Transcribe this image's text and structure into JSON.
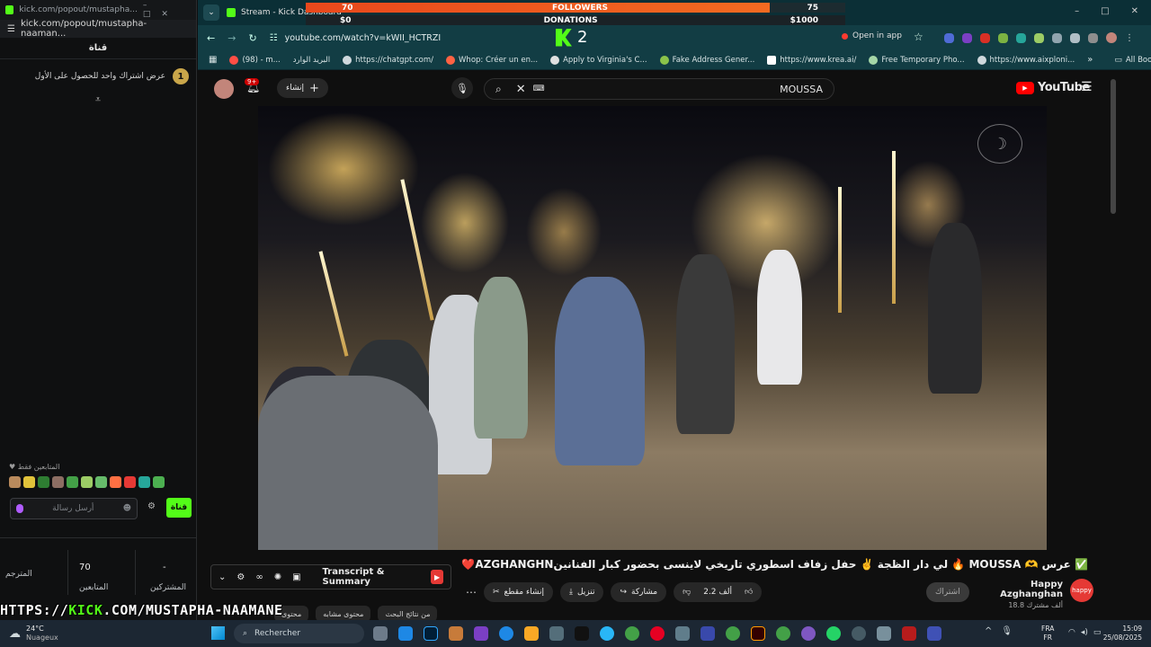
{
  "left_window": {
    "url_title": "kick.com/popout/mustapha...",
    "url": "kick.com/popout/mustapha-naaman...",
    "chat_header": "قناة",
    "pinned_text": "عرض اشتراك واحد للحصول على الأول",
    "pinned_badge": "1",
    "supporters_label": "المتابعين فقط",
    "input_placeholder": "أرسل رسالة",
    "send_label": "قناة",
    "stats": [
      {
        "value": "",
        "label": "المترجم"
      },
      {
        "value": "70",
        "label": "المتابعين"
      },
      {
        "value": "-",
        "label": "المشتركين"
      }
    ]
  },
  "browser": {
    "tab_title": "Stream - Kick Dashboard",
    "url": "youtube.com/watch?v=kWII_HCTRZI",
    "open_in_app": "Open in app",
    "kick_count": "2",
    "bookmarks": [
      {
        "label": "(98) - m...",
        "color": "#ff4e45"
      },
      {
        "label": "البريد الوارد",
        "color": "#ea4335"
      },
      {
        "label": "https://chatgpt.com/",
        "color": "#cfd8dc"
      },
      {
        "label": "Whop: Créer un en...",
        "color": "#ff6243"
      },
      {
        "label": "Apply to Virginia's C...",
        "color": "#e0e0e0"
      },
      {
        "label": "Fake Address Gener...",
        "color": "#8bc34a"
      },
      {
        "label": "https://www.krea.ai/",
        "color": "#ffffff"
      },
      {
        "label": "Free Temporary Pho...",
        "color": "#a5d6a7"
      },
      {
        "label": "https://www.aixploni...",
        "color": "#cfd8dc"
      }
    ],
    "all_bookmarks": "All Bookmarks"
  },
  "overlay": {
    "followers_left": "70",
    "followers_label": "FOLLOWERS",
    "followers_right": "75",
    "donations_left": "$0",
    "donations_label": "DONATIONS",
    "donations_right": "$1000"
  },
  "youtube": {
    "notif_count": "9+",
    "create_label": "إنشاء",
    "search_value": "MOUSSA",
    "logo": "YouTube",
    "video_title": "✅ عرس 🫶 MOUSSA 🔥 لي دار الظجة ✌️ حفل زفاف اسطوري تاريخي لاينسى بحضور كبار الفنانينAZGHANGHN❤️",
    "channel_name": "Happy Azghanghan",
    "subscribers": "18.8 ألف مشترك",
    "subscribe": "اشتراك",
    "likes": "2.2 ألف",
    "share": "مشاركة",
    "download": "تنزيل",
    "clip": "إنشاء مقطع",
    "transcript": "Transcript & Summary",
    "chips": [
      "من نتائج البحث",
      "محتوى مشابه",
      "محتوى"
    ]
  },
  "taskbar": {
    "weather_temp": "24°C",
    "weather_desc": "Nuageux",
    "search": "Rechercher",
    "lang_top": "FRA",
    "lang_bottom": "FR",
    "time": "15:09",
    "date": "25/08/2025"
  },
  "stream_url": {
    "prefix": "HTTPS://",
    "brand": "KICK",
    "suffix": ".COM/MUSTAPHA-NAAMANE"
  }
}
